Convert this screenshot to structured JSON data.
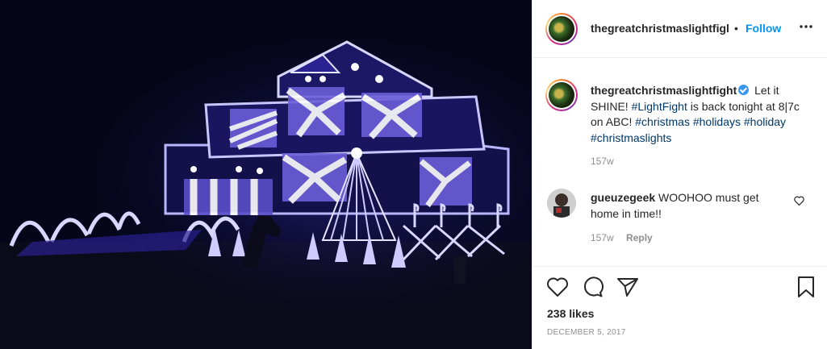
{
  "post": {
    "image_alt": "House decorated with blue and white Christmas lights at night",
    "header": {
      "username": "thegreatchristmaslightfigl",
      "separator": "•",
      "follow_label": "Follow",
      "more_label": "•••"
    },
    "caption": {
      "username": "thegreatchristmaslightfight",
      "text_1": "Let it SHINE!",
      "tag_1": "#LightFight",
      "text_2": "is back tonight at 8|7c on ABC!",
      "tag_2": "#christmas",
      "tag_3": "#holidays",
      "tag_4": "#holiday",
      "tag_5": "#christmaslights",
      "time": "157w"
    },
    "comment": {
      "username": "gueuzegeek",
      "text": "WOOHOO must get home in time!!",
      "time": "157w",
      "reply_label": "Reply"
    },
    "likes": "238 likes",
    "date": "DECEMBER 5, 2017",
    "colors": {
      "accent": "#0095f6",
      "verified": "#3897f0",
      "hashtag": "#00376b",
      "muted": "#8e8e8e"
    }
  }
}
